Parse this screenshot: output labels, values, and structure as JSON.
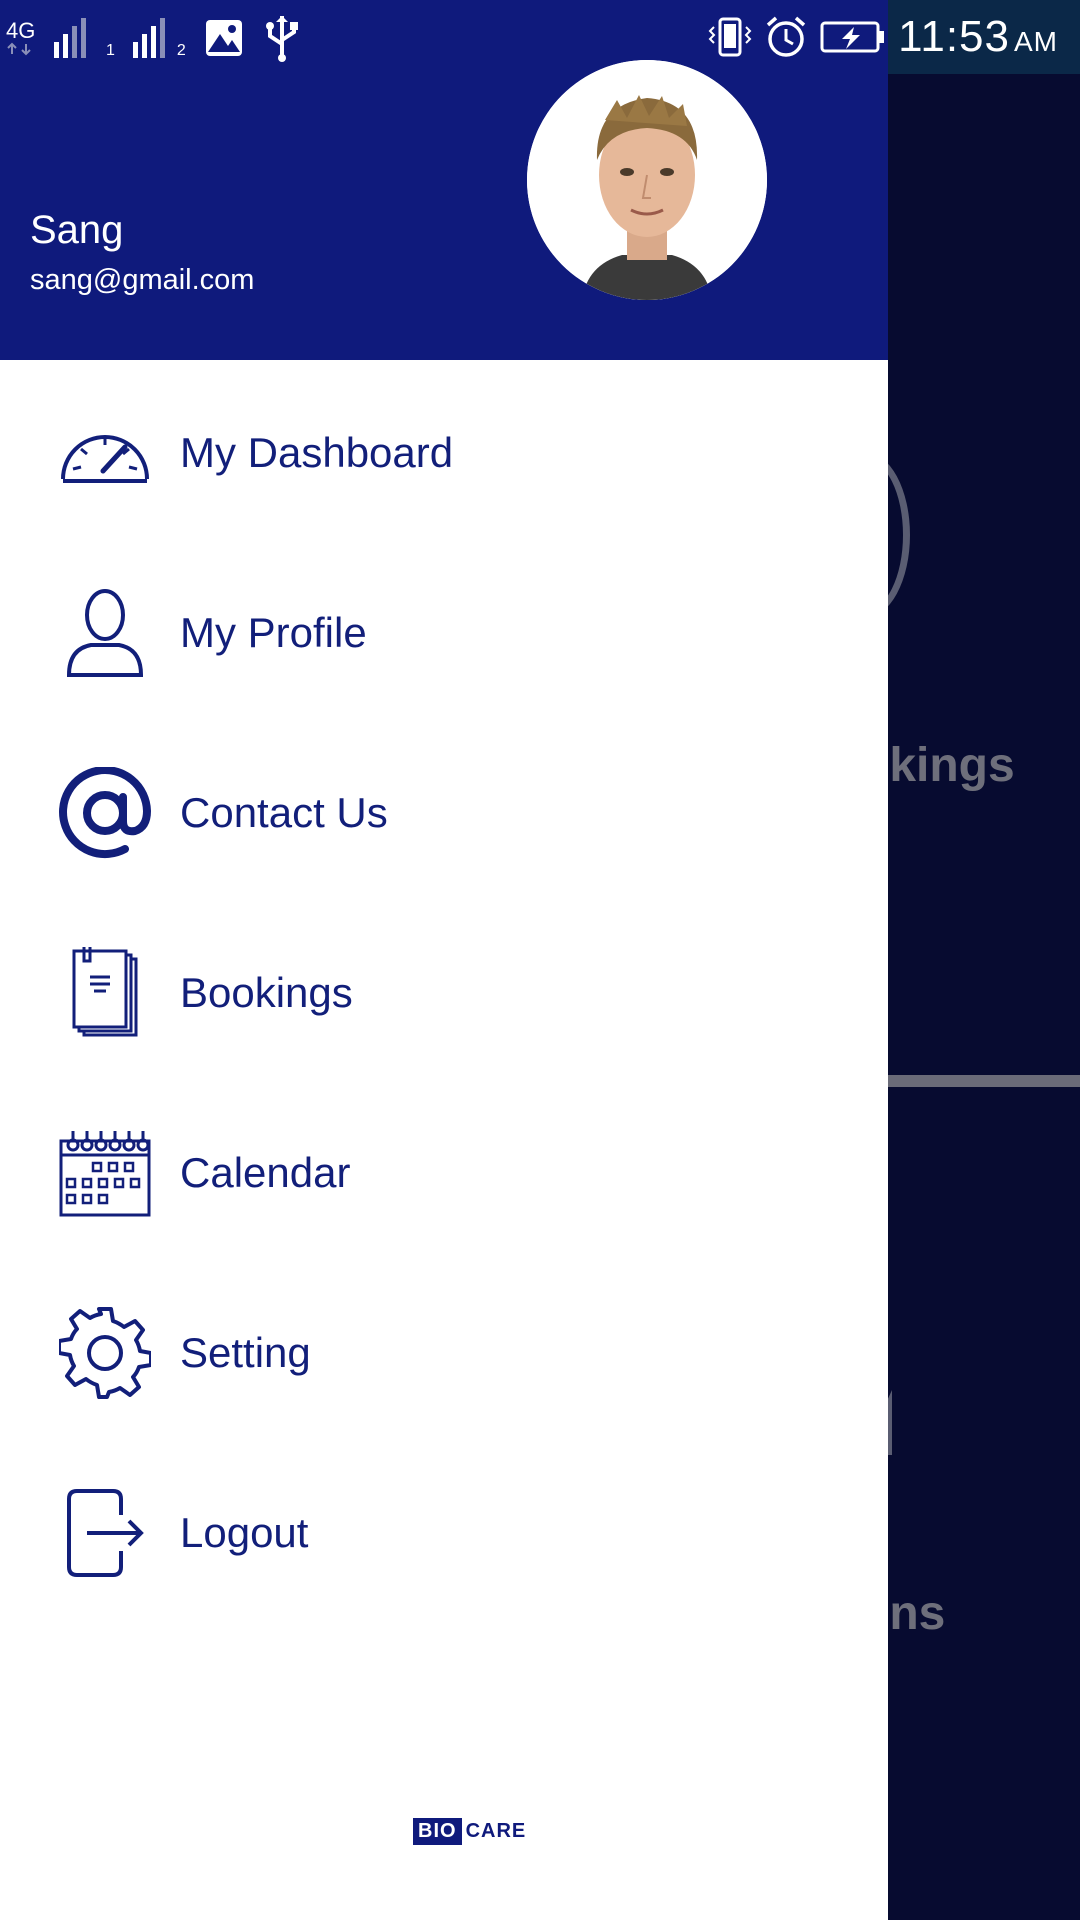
{
  "status_bar": {
    "network_type": "4G",
    "sim1_label": "1",
    "sim2_label": "2",
    "time": "11:53",
    "ampm": "AM"
  },
  "background_app": {
    "text_1": "okings",
    "text_2": "ons"
  },
  "drawer": {
    "user": {
      "name": "Sang",
      "email": "sang@gmail.com"
    },
    "menu_items": [
      {
        "label": "My Dashboard",
        "icon": "dashboard-gauge-icon"
      },
      {
        "label": "My Profile",
        "icon": "profile-user-icon"
      },
      {
        "label": "Contact Us",
        "icon": "at-sign-icon"
      },
      {
        "label": "Bookings",
        "icon": "documents-icon"
      },
      {
        "label": "Calendar",
        "icon": "calendar-icon"
      },
      {
        "label": "Setting",
        "icon": "gear-icon"
      },
      {
        "label": "Logout",
        "icon": "logout-icon"
      }
    ],
    "footer_logo": {
      "part1": "BIO",
      "part2": "CARE"
    }
  },
  "colors": {
    "primary": "#0f1a7c",
    "menu_text": "#121f7a",
    "drawer_bg": "#ffffff",
    "background_app": "#070b30"
  }
}
